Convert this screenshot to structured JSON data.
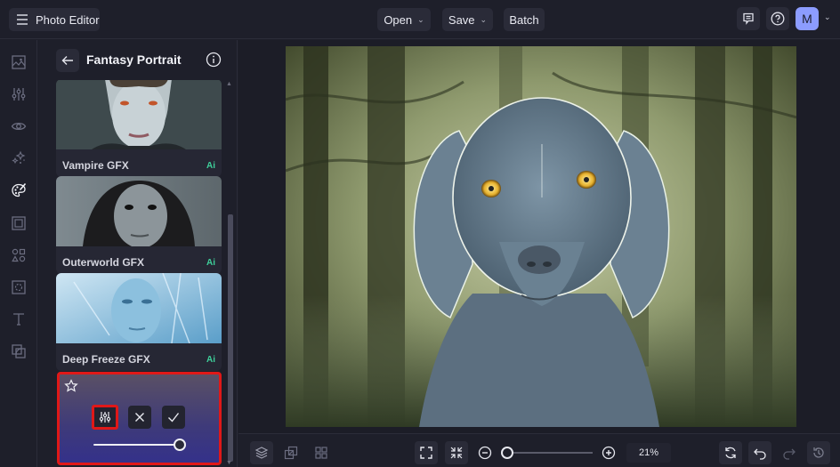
{
  "app": {
    "title": "Photo Editor",
    "menu_icon": "hamburger-icon"
  },
  "toolbar": {
    "open_label": "Open",
    "save_label": "Save",
    "batch_label": "Batch",
    "feedback_icon": "feedback-icon",
    "help_icon": "help-icon",
    "avatar_initial": "M"
  },
  "rail": {
    "items": [
      {
        "name": "image",
        "icon": "image-icon"
      },
      {
        "name": "adjust",
        "icon": "sliders-icon"
      },
      {
        "name": "effects",
        "icon": "eye-icon"
      },
      {
        "name": "touch-up",
        "icon": "sparkles-icon"
      },
      {
        "name": "artsy",
        "icon": "palette-icon",
        "active": true
      },
      {
        "name": "frames",
        "icon": "frame-icon"
      },
      {
        "name": "graphics",
        "icon": "shapes-icon"
      },
      {
        "name": "textures",
        "icon": "texture-icon"
      },
      {
        "name": "text",
        "icon": "text-icon"
      },
      {
        "name": "overlays",
        "icon": "overlay-icon"
      }
    ]
  },
  "panel": {
    "title": "Fantasy Portrait",
    "effects": [
      {
        "name": "Vampire GFX",
        "badge": "Ai"
      },
      {
        "name": "Outerworld GFX",
        "badge": "Ai"
      },
      {
        "name": "Deep Freeze GFX",
        "badge": "Ai"
      }
    ],
    "active_effect": {
      "intensity": 100
    }
  },
  "bottombar": {
    "zoom_value": "21%",
    "zoom_level_fraction": 0.0
  },
  "colors": {
    "accent_avatar": "#8c9cff",
    "ai_badge": "#3ecf9a",
    "highlight": "#e01818",
    "background": "#1e1f2a"
  }
}
